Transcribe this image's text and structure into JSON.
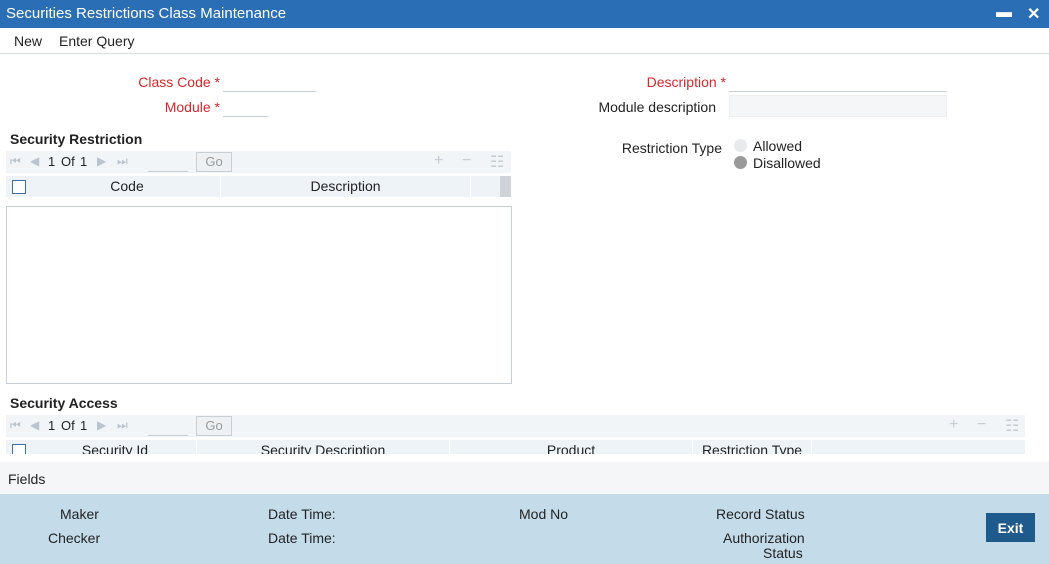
{
  "window": {
    "title": "Securities Restrictions Class Maintenance",
    "minimize": "▬",
    "close": "✕"
  },
  "menu": {
    "new": "New",
    "enter_query": "Enter Query"
  },
  "form": {
    "class_code_label": "Class Code",
    "module_label": "Module",
    "description_label": "Description",
    "module_description_label": "Module description",
    "required_mark": "*",
    "restriction_type_label": "Restriction Type",
    "restriction_options": [
      "Allowed",
      "Disallowed"
    ]
  },
  "security_restriction": {
    "title": "Security Restriction",
    "page_current": "1",
    "page_of": "Of",
    "page_total": "1",
    "go": "Go",
    "columns": [
      "Code",
      "Description"
    ]
  },
  "security_access": {
    "title": "Security Access",
    "page_current": "1",
    "page_of": "Of",
    "page_total": "1",
    "go": "Go",
    "columns": [
      "Security Id",
      "Security Description",
      "Product",
      "Restriction Type"
    ]
  },
  "fields_label": "Fields",
  "footer": {
    "maker": "Maker",
    "checker": "Checker",
    "date_time": "Date Time:",
    "mod_no": "Mod No",
    "record_status": "Record Status",
    "authorization": "Authorization",
    "status": "Status",
    "exit": "Exit"
  },
  "icons": {
    "first": "⏮",
    "prev": "◀",
    "next": "▶",
    "last": "⏭",
    "add": "+",
    "remove": "−",
    "columns": "☷"
  },
  "colors": {
    "titlebar": "#2a6fb5",
    "required": "#d8262b",
    "footer": "#c4dcea",
    "exit": "#1e5a8c"
  }
}
